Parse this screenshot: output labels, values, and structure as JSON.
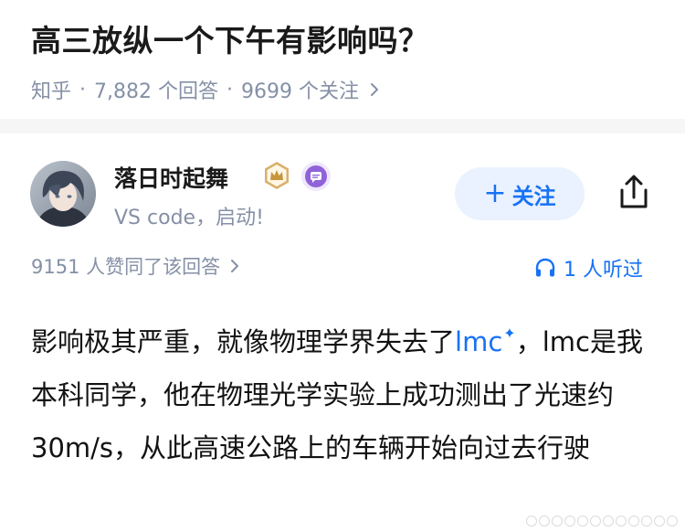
{
  "question": {
    "title": "高三放纵一个下午有影响吗？",
    "source": "知乎",
    "answers_count": "7,882 个回答",
    "followers_count": "9699 个关注"
  },
  "author": {
    "name": "落日时起舞",
    "bio": "VS code，启动!",
    "follow_label": "关注",
    "icons": [
      "avatar",
      "crown-badge-icon",
      "chat-badge-icon",
      "share-icon"
    ]
  },
  "answer": {
    "likes": "9151 人赞同了该回答",
    "listened": "1 人听过",
    "text_before_link": "影响极其严重，就像物理学界失去了",
    "link_text": "lmc",
    "link_mark": "✦",
    "text_after_link": "，lmc是我本科同学，他在物理光学实验上成功测出了光速约 30m/s，从此高速公路上的车辆开始向过去行驶"
  },
  "colors": {
    "accent": "#1772f6",
    "meta": "#8590a6",
    "follow_bg": "#eaf2ff",
    "divider": "#f6f6f6"
  }
}
